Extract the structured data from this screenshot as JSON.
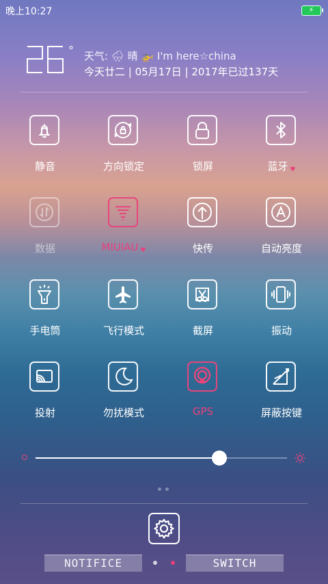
{
  "status_bar": {
    "time": "晚上10:27",
    "battery_charging": true,
    "battery_color": "#23c85a"
  },
  "weather": {
    "temperature": "26",
    "degree_symbol": "°",
    "line1": "天气: 🌧 晴 🚁  I'm here☆china",
    "line2": "今天廿二 | 05月17日 | 2017年已过137天"
  },
  "toggles": [
    {
      "label": "静音",
      "icon": "bell-icon",
      "state": "on"
    },
    {
      "label": "方向锁定",
      "icon": "rotation-lock-icon",
      "state": "on"
    },
    {
      "label": "锁屏",
      "icon": "padlock-icon",
      "state": "on"
    },
    {
      "label": "蓝牙",
      "icon": "bluetooth-icon",
      "state": "on",
      "heart": true
    },
    {
      "label": "数据",
      "icon": "data-arrows-icon",
      "state": "disabled"
    },
    {
      "label": "MIUIAU",
      "icon": "filter-lines-icon",
      "state": "active",
      "heart": true
    },
    {
      "label": "快传",
      "icon": "upload-arrow-icon",
      "state": "on"
    },
    {
      "label": "自动亮度",
      "icon": "auto-brightness-icon",
      "state": "on"
    },
    {
      "label": "手电筒",
      "icon": "flashlight-icon",
      "state": "on"
    },
    {
      "label": "飞行模式",
      "icon": "airplane-icon",
      "state": "on"
    },
    {
      "label": "截屏",
      "icon": "scissors-icon",
      "state": "on"
    },
    {
      "label": "振动",
      "icon": "vibrate-icon",
      "state": "on"
    },
    {
      "label": "投射",
      "icon": "cast-icon",
      "state": "on"
    },
    {
      "label": "勿扰模式",
      "icon": "moon-icon",
      "state": "on"
    },
    {
      "label": "GPS",
      "icon": "gps-icon",
      "state": "active"
    },
    {
      "label": "屏蔽按键",
      "icon": "block-keys-icon",
      "state": "on"
    }
  ],
  "brightness": {
    "level": 0.73,
    "low_icon": "brightness-low-icon",
    "high_icon": "brightness-high-icon"
  },
  "settings": {
    "icon": "gear-icon"
  },
  "tabs": {
    "notifice_label": "NOTIFICE",
    "switch_label": "SWITCH",
    "active": "switch"
  },
  "colors": {
    "accent_pink": "#ea3f7d",
    "white": "#ffffff"
  }
}
